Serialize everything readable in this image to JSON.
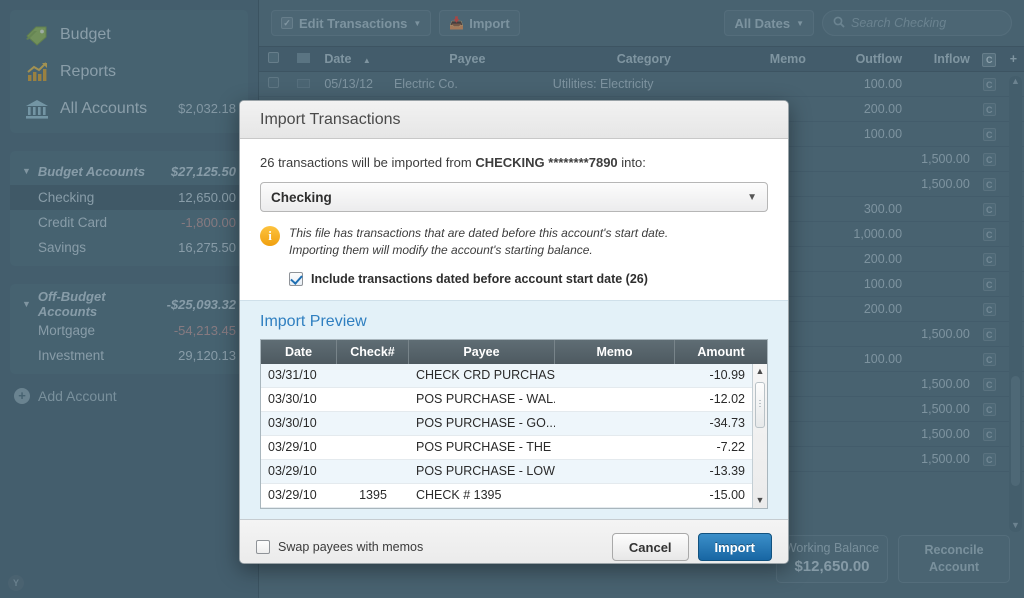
{
  "sidebar": {
    "nav": [
      {
        "label": "Budget",
        "icon": "tag-icon",
        "amount": ""
      },
      {
        "label": "Reports",
        "icon": "chart-icon",
        "amount": ""
      },
      {
        "label": "All Accounts",
        "icon": "bank-icon",
        "amount": "$2,032.18"
      }
    ],
    "budget_group": {
      "label": "Budget Accounts",
      "amount": "$27,125.50"
    },
    "budget_accounts": [
      {
        "label": "Checking",
        "amount": "12,650.00",
        "selected": true
      },
      {
        "label": "Credit Card",
        "amount": "-1,800.00",
        "negative": true
      },
      {
        "label": "Savings",
        "amount": "16,275.50"
      }
    ],
    "offbudget_group": {
      "label": "Off-Budget Accounts",
      "amount": "-$25,093.32"
    },
    "offbudget_accounts": [
      {
        "label": "Mortgage",
        "amount": "-54,213.45",
        "negative": true
      },
      {
        "label": "Investment",
        "amount": "29,120.13"
      }
    ],
    "add_account_label": "Add Account",
    "logo_label": "Y"
  },
  "toolbar": {
    "edit_transactions_label": "Edit Transactions",
    "import_label": "Import",
    "all_dates_label": "All Dates",
    "search_placeholder": "Search Checking",
    "caret": "▼",
    "search_icon": "🔍"
  },
  "register": {
    "columns": [
      "Date",
      "Payee",
      "Category",
      "Memo",
      "Outflow",
      "Inflow",
      "C",
      "+"
    ],
    "sort_indicator": "▲",
    "rows": [
      {
        "date": "05/13/12",
        "payee": "Electric Co.",
        "category": "Utilities: Electricity",
        "memo": "",
        "outflow": "100.00",
        "inflow": "",
        "c": "C"
      },
      {
        "date": "",
        "payee": "",
        "category": "",
        "memo": "",
        "outflow": "200.00",
        "inflow": "",
        "c": "C"
      },
      {
        "date": "",
        "payee": "",
        "category": "",
        "memo": "",
        "outflow": "100.00",
        "inflow": "",
        "c": "C"
      },
      {
        "date": "",
        "payee": "",
        "category": "",
        "memo": "",
        "outflow": "",
        "inflow": "1,500.00",
        "c": "C"
      },
      {
        "date": "",
        "payee": "",
        "category": "",
        "memo": "",
        "outflow": "",
        "inflow": "1,500.00",
        "c": "C"
      },
      {
        "date": "",
        "payee": "",
        "category": "",
        "memo": "",
        "outflow": "300.00",
        "inflow": "",
        "c": "C"
      },
      {
        "date": "",
        "payee": "",
        "category": "",
        "memo": "",
        "outflow": "1,000.00",
        "inflow": "",
        "c": "C"
      },
      {
        "date": "",
        "payee": "",
        "category": "",
        "memo": "",
        "outflow": "200.00",
        "inflow": "",
        "c": "C"
      },
      {
        "date": "",
        "payee": "",
        "category": "",
        "memo": "",
        "outflow": "100.00",
        "inflow": "",
        "c": "C"
      },
      {
        "date": "",
        "payee": "",
        "category": "",
        "memo": "",
        "outflow": "200.00",
        "inflow": "",
        "c": "C"
      },
      {
        "date": "",
        "payee": "",
        "category": "",
        "memo": "",
        "outflow": "",
        "inflow": "1,500.00",
        "c": "C"
      },
      {
        "date": "",
        "payee": "",
        "category": "",
        "memo": "",
        "outflow": "100.00",
        "inflow": "",
        "c": "C"
      },
      {
        "date": "",
        "payee": "",
        "category": "",
        "memo": "",
        "outflow": "",
        "inflow": "1,500.00",
        "c": "C"
      },
      {
        "date": "",
        "payee": "",
        "category": "",
        "memo": "",
        "outflow": "",
        "inflow": "1,500.00",
        "c": "C"
      },
      {
        "date": "",
        "payee": "",
        "category": "",
        "memo": "",
        "outflow": "",
        "inflow": "1,500.00",
        "c": "C"
      },
      {
        "date": "",
        "payee": "",
        "category": "",
        "memo": "",
        "outflow": "",
        "inflow": "1,500.00",
        "c": "C"
      }
    ],
    "working_balance_label": "Working Balance",
    "working_balance_value": "$12,650.00",
    "reconcile_label_1": "Reconcile",
    "reconcile_label_2": "Account"
  },
  "modal": {
    "title": "Import Transactions",
    "summary_prefix": "26 transactions will be imported from ",
    "summary_account": "CHECKING ********7890",
    "summary_suffix": " into:",
    "account_value": "Checking",
    "account_caret": "▼",
    "warning_icon_glyph": "i",
    "warning_line1": "This file has transactions that are dated before this account's start date.",
    "warning_line2": "Importing them will modify the account's starting balance.",
    "include_checkbox_label": "Include transactions dated before account start date (26)",
    "include_checked": true,
    "preview_title": "Import Preview",
    "preview_columns": [
      "Date",
      "Check#",
      "Payee",
      "Memo",
      "Amount"
    ],
    "preview_rows": [
      {
        "date": "03/31/10",
        "check": "",
        "payee": "CHECK CRD PURCHAS...",
        "memo": "",
        "amount": "-10.99"
      },
      {
        "date": "03/30/10",
        "check": "",
        "payee": "POS PURCHASE - WAL...",
        "memo": "",
        "amount": "-12.02"
      },
      {
        "date": "03/30/10",
        "check": "",
        "payee": "POS PURCHASE - GO...",
        "memo": "",
        "amount": "-34.73"
      },
      {
        "date": "03/29/10",
        "check": "",
        "payee": "POS PURCHASE - THE ...",
        "memo": "",
        "amount": "-7.22"
      },
      {
        "date": "03/29/10",
        "check": "",
        "payee": "POS PURCHASE - LOW...",
        "memo": "",
        "amount": "-13.39"
      },
      {
        "date": "03/29/10",
        "check": "1395",
        "payee": "CHECK # 1395",
        "memo": "",
        "amount": "-15.00"
      }
    ],
    "swap_label": "Swap payees with memos",
    "swap_checked": false,
    "cancel_label": "Cancel",
    "import_label": "Import",
    "scroll_up_glyph": "▲",
    "scroll_down_glyph": "▼"
  },
  "colors": {
    "accent_blue": "#2f7fc0",
    "import_button": "#1866a3",
    "warning_orange": "#f0a00f",
    "app_background": "#4a6475",
    "preview_panel": "#e3f1f8"
  }
}
